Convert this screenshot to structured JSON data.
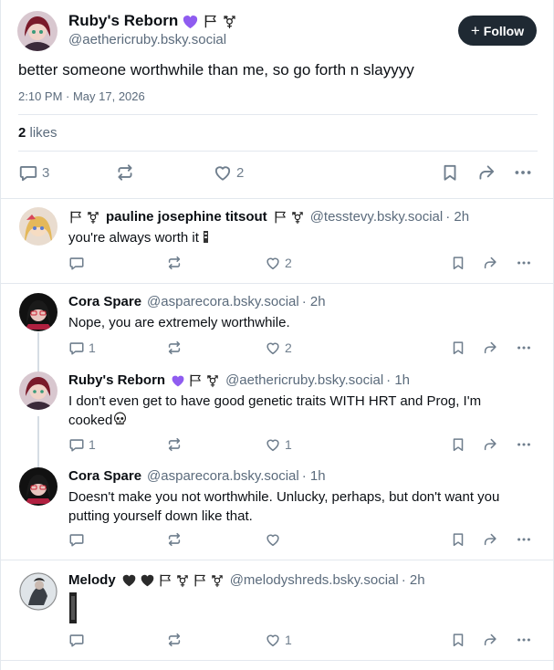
{
  "post": {
    "author_name": "Ruby's Reborn",
    "handle": "@aethericruby.bsky.social",
    "follow_label": "Follow",
    "text": "better someone worthwhile than me, so go forth n slayyyy",
    "timestamp": "2:10 PM · May 17, 2026",
    "likes_count": "2",
    "likes_label": "likes",
    "reply_count": "3",
    "repost_count": "",
    "like_count": "2"
  },
  "replies": [
    {
      "author_name": "pauline josephine titsout",
      "handle": "@tesstevy.bsky.social",
      "time": "· 2h",
      "text": "you're always worth it",
      "reply_count": "",
      "like_count": "2"
    },
    {
      "author_name": "Cora Spare",
      "handle": "@asparecora.bsky.social",
      "time": "· 2h",
      "text": "Nope, you are extremely worthwhile.",
      "reply_count": "1",
      "like_count": "2"
    },
    {
      "author_name": "Ruby's Reborn",
      "handle": "@aethericruby.bsky.social",
      "time": "· 1h",
      "text_line1": "I don't even get to have good genetic traits WITH HRT and Prog, I'm",
      "text_line2": "cooked",
      "reply_count": "1",
      "like_count": "1"
    },
    {
      "author_name": "Cora Spare",
      "handle": "@asparecora.bsky.social",
      "time": "· 1h",
      "text_line1": "Doesn't make you not worthwhile. Unlucky, perhaps, but don't want you",
      "text_line2": "putting yourself down like that.",
      "reply_count": "",
      "like_count": ""
    },
    {
      "author_name": "Melody",
      "handle": "@melodyshreds.bsky.social",
      "time": "· 2h",
      "reply_count": "",
      "like_count": "1"
    }
  ],
  "colors": {
    "accent": "#7b5bff",
    "follow_bg": "#1f2933",
    "muted": "#5b6b7c",
    "border": "#e3e8ee"
  },
  "icons": [
    "reply-icon",
    "repost-icon",
    "like-icon",
    "bookmark-icon",
    "share-icon",
    "more-icon",
    "heart-icon",
    "flag-icon",
    "transgender-icon",
    "skull-icon"
  ]
}
